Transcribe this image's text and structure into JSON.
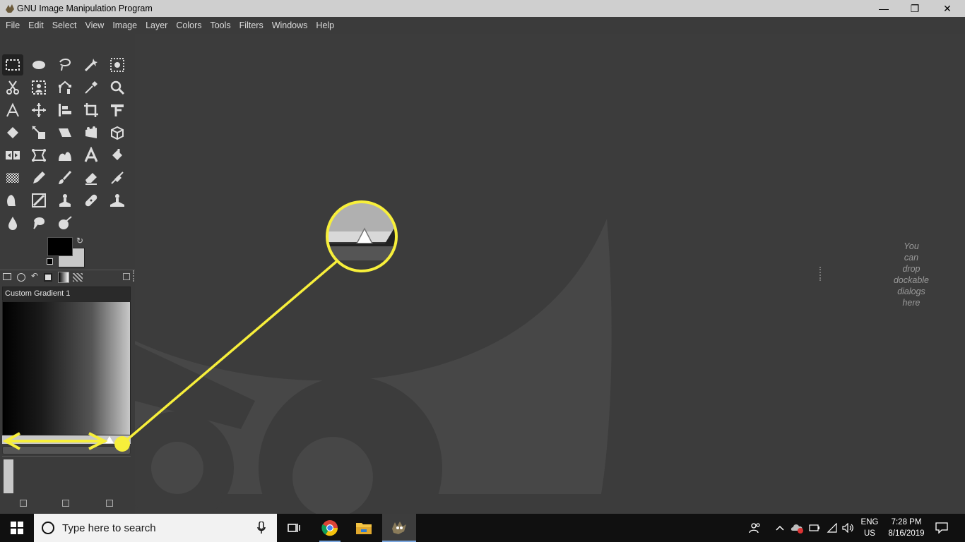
{
  "window": {
    "title": "GNU Image Manipulation Program",
    "minimize": "—",
    "restore": "❐",
    "close": "✕"
  },
  "menu": [
    "File",
    "Edit",
    "Select",
    "View",
    "Image",
    "Layer",
    "Colors",
    "Tools",
    "Filters",
    "Windows",
    "Help"
  ],
  "gradient_editor": {
    "name_value": "Custom Gradient 1"
  },
  "dock_hint": [
    "You",
    "can",
    "drop",
    "dockable",
    "dialogs",
    "here"
  ],
  "taskbar": {
    "search_placeholder": "Type here to search",
    "language": "ENG",
    "region": "US",
    "time": "7:28 PM",
    "date": "8/16/2019"
  },
  "colors": {
    "accent_yellow": "#f7ef3b",
    "canvas_bg": "#3c3c3c",
    "panel_bg": "#3b3b3b"
  },
  "tool_icons": [
    "rect-select-icon",
    "ellipse-select-icon",
    "free-select-icon",
    "fuzzy-select-icon",
    "select-by-color-icon",
    "scissors-select-icon",
    "foreground-select-icon",
    "paths-icon",
    "color-picker-icon",
    "zoom-icon",
    "measure-icon",
    "move-icon",
    "align-icon",
    "crop-icon",
    "unified-transform-icon",
    "rotate-icon",
    "scale-icon",
    "shear-icon",
    "perspective-icon",
    "3d-transform-icon",
    "flip-icon",
    "cage-transform-icon",
    "warp-transform-icon",
    "text-icon",
    "bucket-fill-icon",
    "gradient-icon",
    "pencil-icon",
    "paintbrush-icon",
    "eraser-icon",
    "airbrush-icon",
    "ink-icon",
    "mypaint-brush-icon",
    "clone-icon",
    "heal-icon",
    "perspective-clone-icon",
    "blur-icon",
    "smudge-icon",
    "dodge-burn-icon"
  ]
}
